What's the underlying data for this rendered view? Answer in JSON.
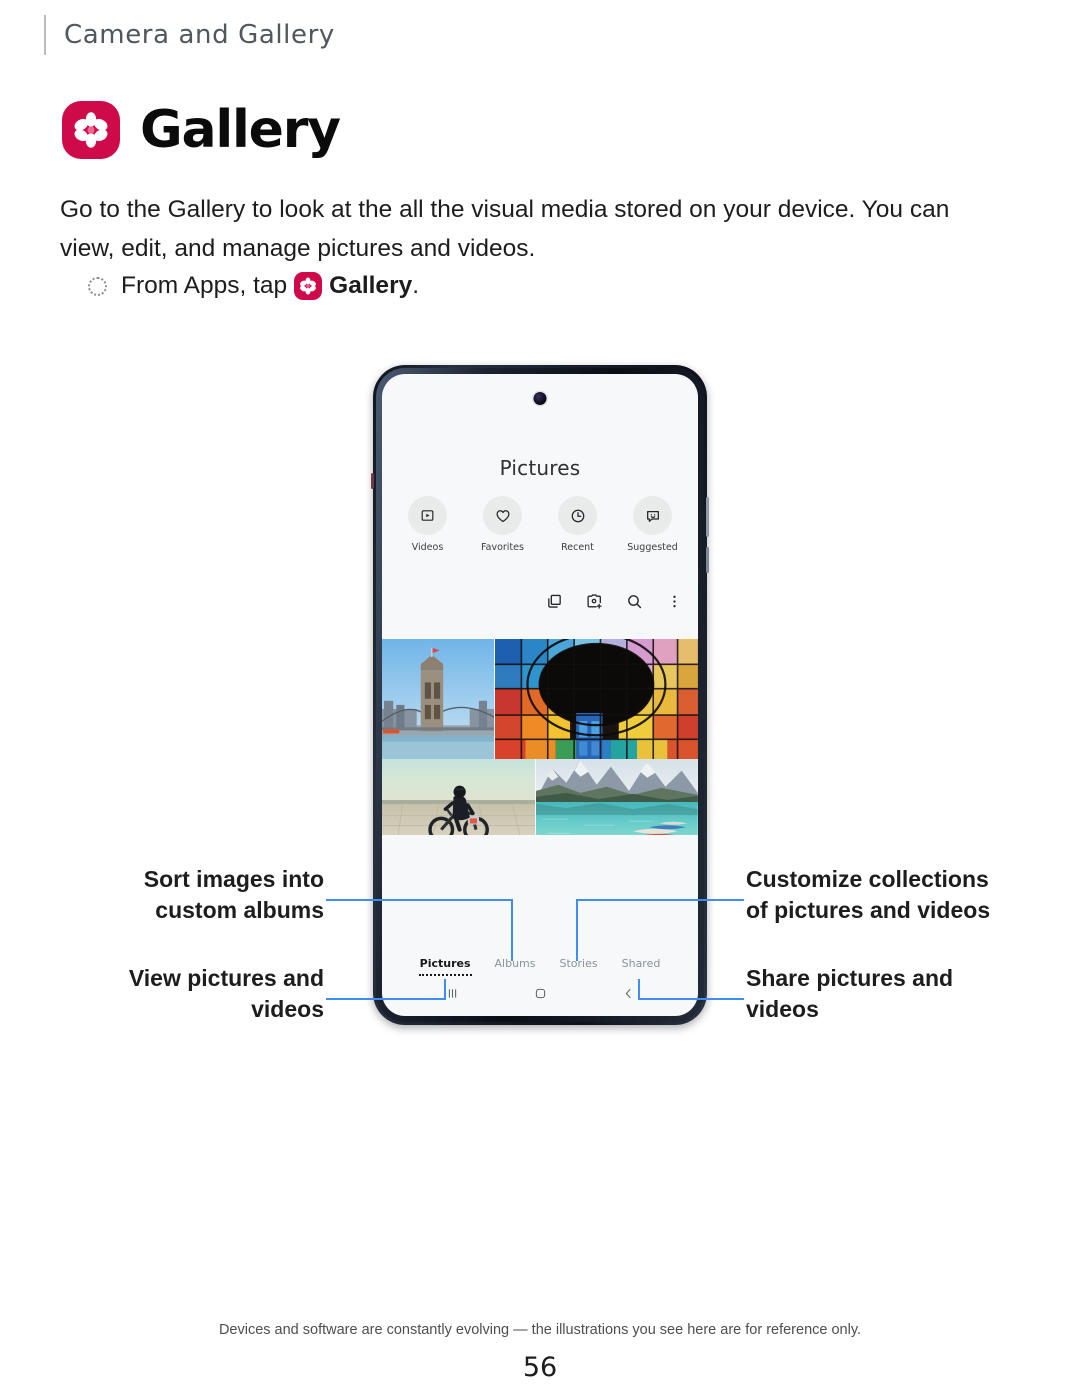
{
  "header": {
    "section_title": "Camera and Gallery"
  },
  "app": {
    "title": "Gallery",
    "icon_name": "gallery-flower-icon",
    "brand_color": "#cf0a4b"
  },
  "intro": {
    "paragraph": "Go to the Gallery to look at the all the visual media stored on your device. You can view, edit, and manage pictures and videos."
  },
  "bullet": {
    "prefix": "From Apps, tap",
    "app_name": "Gallery",
    "suffix": "."
  },
  "phone": {
    "screen": {
      "app_title": "Pictures",
      "quick_access": [
        {
          "label": "Videos",
          "icon": "video-play-icon"
        },
        {
          "label": "Favorites",
          "icon": "heart-icon"
        },
        {
          "label": "Recent",
          "icon": "clock-icon"
        },
        {
          "label": "Suggested",
          "icon": "suggestion-face-icon"
        }
      ],
      "toolbar": [
        {
          "name": "create-collage-icon"
        },
        {
          "name": "add-to-album-icon"
        },
        {
          "name": "search-icon"
        },
        {
          "name": "more-options-icon"
        }
      ],
      "photos": [
        {
          "name": "brooklyn-bridge-photo"
        },
        {
          "name": "stained-glass-ceiling-photo"
        },
        {
          "name": "motorcycle-desert-photo"
        },
        {
          "name": "mountain-lake-canoes-photo"
        }
      ],
      "tabs": [
        {
          "label": "Pictures",
          "active": true
        },
        {
          "label": "Albums",
          "active": false
        },
        {
          "label": "Stories",
          "active": false
        },
        {
          "label": "Shared",
          "active": false
        }
      ],
      "nav_buttons": [
        {
          "name": "recents-button"
        },
        {
          "name": "home-button"
        },
        {
          "name": "back-button"
        }
      ]
    }
  },
  "callouts": {
    "sort": "Sort images into custom albums",
    "view": "View pictures and videos",
    "customize": "Customize collections of pictures and videos",
    "share": "Share pictures and videos",
    "leader_color": "#3d8ef0"
  },
  "footer": {
    "note": "Devices and software are constantly evolving — the illustrations you see here are for reference only.",
    "page_number": "56"
  }
}
